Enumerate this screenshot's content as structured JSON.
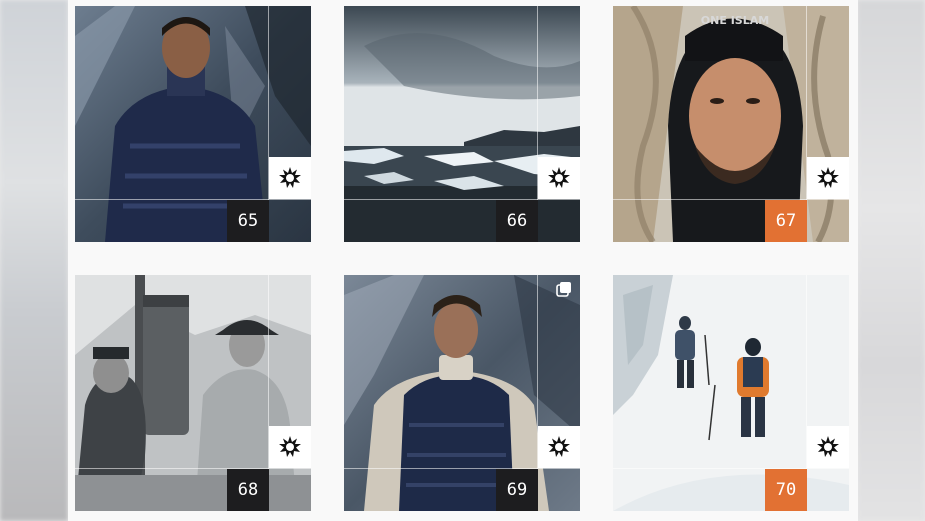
{
  "grid": {
    "tiles": [
      {
        "number": "65",
        "badge_style": "dark",
        "icon": "sun-burst-icon",
        "scene": "man in navy down jacket in front of ice"
      },
      {
        "number": "66",
        "badge_style": "dark",
        "icon": "sun-burst-icon",
        "scene": "icebergs in glacial lagoon under grey sky"
      },
      {
        "number": "67",
        "badge_style": "accent",
        "icon": "sun-burst-icon",
        "scene": "man in fur-trimmed hood and beanie",
        "beanie_text": "ONE ISLAM"
      },
      {
        "number": "68",
        "badge_style": "dark",
        "icon": "sun-burst-icon",
        "scene": "vintage photo of two expedition men"
      },
      {
        "number": "69",
        "badge_style": "dark",
        "icon": "sun-burst-icon",
        "scene": "man in navy down vest and knit sweater",
        "multi_image_icon": "gallery-stack-icon"
      },
      {
        "number": "70",
        "badge_style": "accent",
        "icon": "sun-burst-icon",
        "scene": "two climbers on snowy glacier"
      }
    ]
  },
  "colors": {
    "badge_dark": "#1d1d1f",
    "badge_accent": "#e27133",
    "page_bg": "#f9f9f9"
  }
}
